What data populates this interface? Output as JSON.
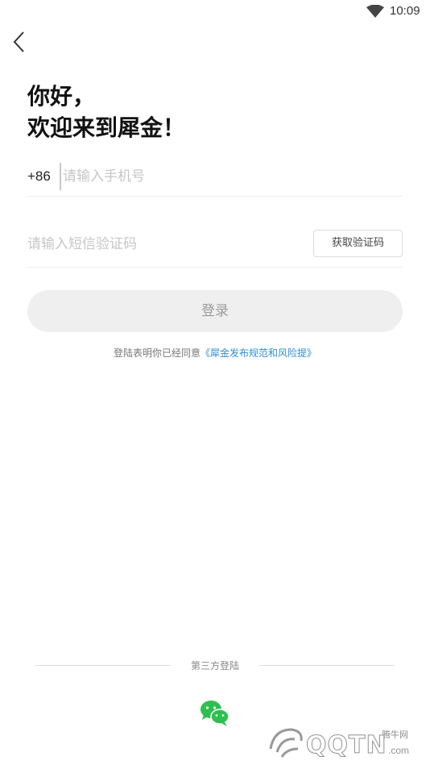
{
  "status_bar": {
    "time": "10:09",
    "wifi_icon": "wifi-icon"
  },
  "nav": {
    "back_icon": "chevron-left-icon"
  },
  "welcome": {
    "line1": "你好，",
    "line2": "欢迎来到犀金！"
  },
  "phone": {
    "country_code": "+86",
    "placeholder": "请输入手机号",
    "value": ""
  },
  "code": {
    "placeholder": "请输入短信验证码",
    "value": "",
    "get_code_label": "获取验证码"
  },
  "login": {
    "label": "登录"
  },
  "agreement": {
    "prefix": "登陆表明你已经同意",
    "link": "《犀金发布规范和风险提》"
  },
  "third_party": {
    "label": "第三方登陆",
    "wechat_icon": "wechat-icon"
  },
  "watermark": {
    "text": "QQTN",
    "suffix": ".com",
    "cn": "腾牛网"
  },
  "colors": {
    "accent_link": "#2e8fd6",
    "wechat_green": "#2ec04f",
    "login_bg": "#efefef"
  }
}
